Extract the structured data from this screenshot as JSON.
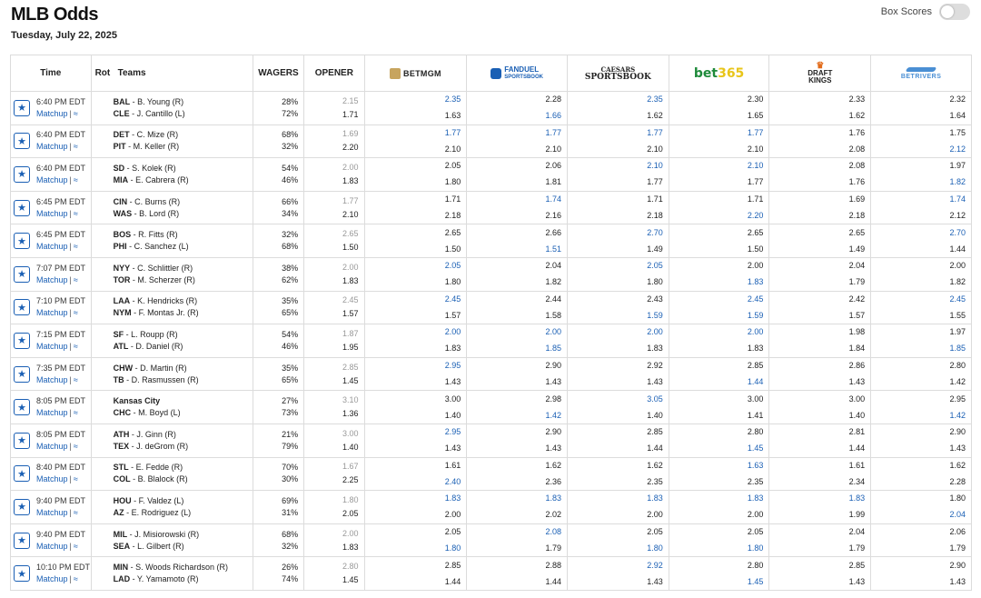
{
  "page": {
    "title": "MLB Odds",
    "date": "Tuesday, July 22, 2025",
    "box_scores_label": "Box Scores",
    "box_scores_on": false
  },
  "headers": {
    "time": "Time",
    "rot": "Rot",
    "teams": "Teams",
    "wagers": "WAGERS",
    "opener": "OPENER"
  },
  "books": [
    {
      "key": "betmgm",
      "label": "BETMGM"
    },
    {
      "key": "fanduel",
      "label": "FANDUEL",
      "sub": "SPORTSBOOK"
    },
    {
      "key": "caesars",
      "label": "CAESARS",
      "sub": "SPORTSBOOK"
    },
    {
      "key": "bet365",
      "label": "bet365"
    },
    {
      "key": "draftkings",
      "label": "DRAFT",
      "sub": "KINGS"
    },
    {
      "key": "betrivers",
      "label": "BETRIVERS"
    }
  ],
  "matchup_label": "Matchup",
  "colors": {
    "best_odds": "#1a5fb4",
    "opener_top": "#999999"
  },
  "games": [
    {
      "time": "6:40 PM EDT",
      "away": {
        "abbr": "BAL",
        "pitcher": "B. Young (R)"
      },
      "home": {
        "abbr": "CLE",
        "pitcher": "J. Cantillo (L)"
      },
      "wagers": [
        "28%",
        "72%"
      ],
      "opener": [
        "2.15",
        "1.71"
      ],
      "odds": [
        [
          "2.35",
          "1.63"
        ],
        [
          "2.28",
          "1.66"
        ],
        [
          "2.35",
          "1.62"
        ],
        [
          "2.30",
          "1.65"
        ],
        [
          "2.33",
          "1.62"
        ],
        [
          "2.32",
          "1.64"
        ]
      ],
      "best": [
        [
          1,
          0
        ],
        [
          0,
          1
        ],
        [
          1,
          0
        ],
        [
          0,
          0
        ],
        [
          0,
          0
        ],
        [
          0,
          0
        ]
      ]
    },
    {
      "time": "6:40 PM EDT",
      "away": {
        "abbr": "DET",
        "pitcher": "C. Mize (R)"
      },
      "home": {
        "abbr": "PIT",
        "pitcher": "M. Keller (R)"
      },
      "wagers": [
        "68%",
        "32%"
      ],
      "opener": [
        "1.69",
        "2.20"
      ],
      "odds": [
        [
          "1.77",
          "2.10"
        ],
        [
          "1.77",
          "2.10"
        ],
        [
          "1.77",
          "2.10"
        ],
        [
          "1.77",
          "2.10"
        ],
        [
          "1.76",
          "2.08"
        ],
        [
          "1.75",
          "2.12"
        ]
      ],
      "best": [
        [
          1,
          0
        ],
        [
          1,
          0
        ],
        [
          1,
          0
        ],
        [
          1,
          0
        ],
        [
          0,
          0
        ],
        [
          0,
          1
        ]
      ]
    },
    {
      "time": "6:40 PM EDT",
      "away": {
        "abbr": "SD",
        "pitcher": "S. Kolek (R)"
      },
      "home": {
        "abbr": "MIA",
        "pitcher": "E. Cabrera (R)"
      },
      "wagers": [
        "54%",
        "46%"
      ],
      "opener": [
        "2.00",
        "1.83"
      ],
      "odds": [
        [
          "2.05",
          "1.80"
        ],
        [
          "2.06",
          "1.81"
        ],
        [
          "2.10",
          "1.77"
        ],
        [
          "2.10",
          "1.77"
        ],
        [
          "2.08",
          "1.76"
        ],
        [
          "1.97",
          "1.82"
        ]
      ],
      "best": [
        [
          0,
          0
        ],
        [
          0,
          0
        ],
        [
          1,
          0
        ],
        [
          1,
          0
        ],
        [
          0,
          0
        ],
        [
          0,
          1
        ]
      ]
    },
    {
      "time": "6:45 PM EDT",
      "away": {
        "abbr": "CIN",
        "pitcher": "C. Burns (R)"
      },
      "home": {
        "abbr": "WAS",
        "pitcher": "B. Lord (R)"
      },
      "wagers": [
        "66%",
        "34%"
      ],
      "opener": [
        "1.77",
        "2.10"
      ],
      "odds": [
        [
          "1.71",
          "2.18"
        ],
        [
          "1.74",
          "2.16"
        ],
        [
          "1.71",
          "2.18"
        ],
        [
          "1.71",
          "2.20"
        ],
        [
          "1.69",
          "2.18"
        ],
        [
          "1.74",
          "2.12"
        ]
      ],
      "best": [
        [
          0,
          0
        ],
        [
          1,
          0
        ],
        [
          0,
          0
        ],
        [
          0,
          1
        ],
        [
          0,
          0
        ],
        [
          1,
          0
        ]
      ]
    },
    {
      "time": "6:45 PM EDT",
      "away": {
        "abbr": "BOS",
        "pitcher": "R. Fitts (R)"
      },
      "home": {
        "abbr": "PHI",
        "pitcher": "C. Sanchez (L)"
      },
      "wagers": [
        "32%",
        "68%"
      ],
      "opener": [
        "2.65",
        "1.50"
      ],
      "odds": [
        [
          "2.65",
          "1.50"
        ],
        [
          "2.66",
          "1.51"
        ],
        [
          "2.70",
          "1.49"
        ],
        [
          "2.65",
          "1.50"
        ],
        [
          "2.65",
          "1.49"
        ],
        [
          "2.70",
          "1.44"
        ]
      ],
      "best": [
        [
          0,
          0
        ],
        [
          0,
          1
        ],
        [
          1,
          0
        ],
        [
          0,
          0
        ],
        [
          0,
          0
        ],
        [
          1,
          0
        ]
      ]
    },
    {
      "time": "7:07 PM EDT",
      "away": {
        "abbr": "NYY",
        "pitcher": "C. Schlittler (R)"
      },
      "home": {
        "abbr": "TOR",
        "pitcher": "M. Scherzer (R)"
      },
      "wagers": [
        "38%",
        "62%"
      ],
      "opener": [
        "2.00",
        "1.83"
      ],
      "odds": [
        [
          "2.05",
          "1.80"
        ],
        [
          "2.04",
          "1.82"
        ],
        [
          "2.05",
          "1.80"
        ],
        [
          "2.00",
          "1.83"
        ],
        [
          "2.04",
          "1.79"
        ],
        [
          "2.00",
          "1.82"
        ]
      ],
      "best": [
        [
          1,
          0
        ],
        [
          0,
          0
        ],
        [
          1,
          0
        ],
        [
          0,
          1
        ],
        [
          0,
          0
        ],
        [
          0,
          0
        ]
      ]
    },
    {
      "time": "7:10 PM EDT",
      "away": {
        "abbr": "LAA",
        "pitcher": "K. Hendricks (R)"
      },
      "home": {
        "abbr": "NYM",
        "pitcher": "F. Montas Jr. (R)"
      },
      "wagers": [
        "35%",
        "65%"
      ],
      "opener": [
        "2.45",
        "1.57"
      ],
      "odds": [
        [
          "2.45",
          "1.57"
        ],
        [
          "2.44",
          "1.58"
        ],
        [
          "2.43",
          "1.59"
        ],
        [
          "2.45",
          "1.59"
        ],
        [
          "2.42",
          "1.57"
        ],
        [
          "2.45",
          "1.55"
        ]
      ],
      "best": [
        [
          1,
          0
        ],
        [
          0,
          0
        ],
        [
          0,
          1
        ],
        [
          1,
          1
        ],
        [
          0,
          0
        ],
        [
          1,
          0
        ]
      ]
    },
    {
      "time": "7:15 PM EDT",
      "away": {
        "abbr": "SF",
        "pitcher": "L. Roupp (R)"
      },
      "home": {
        "abbr": "ATL",
        "pitcher": "D. Daniel (R)"
      },
      "wagers": [
        "54%",
        "46%"
      ],
      "opener": [
        "1.87",
        "1.95"
      ],
      "odds": [
        [
          "2.00",
          "1.83"
        ],
        [
          "2.00",
          "1.85"
        ],
        [
          "2.00",
          "1.83"
        ],
        [
          "2.00",
          "1.83"
        ],
        [
          "1.98",
          "1.84"
        ],
        [
          "1.97",
          "1.85"
        ]
      ],
      "best": [
        [
          1,
          0
        ],
        [
          1,
          1
        ],
        [
          1,
          0
        ],
        [
          1,
          0
        ],
        [
          0,
          0
        ],
        [
          0,
          1
        ]
      ]
    },
    {
      "time": "7:35 PM EDT",
      "away": {
        "abbr": "CHW",
        "pitcher": "D. Martin (R)"
      },
      "home": {
        "abbr": "TB",
        "pitcher": "D. Rasmussen (R)"
      },
      "wagers": [
        "35%",
        "65%"
      ],
      "opener": [
        "2.85",
        "1.45"
      ],
      "odds": [
        [
          "2.95",
          "1.43"
        ],
        [
          "2.90",
          "1.43"
        ],
        [
          "2.92",
          "1.43"
        ],
        [
          "2.85",
          "1.44"
        ],
        [
          "2.86",
          "1.43"
        ],
        [
          "2.80",
          "1.42"
        ]
      ],
      "best": [
        [
          1,
          0
        ],
        [
          0,
          0
        ],
        [
          0,
          0
        ],
        [
          0,
          1
        ],
        [
          0,
          0
        ],
        [
          0,
          0
        ]
      ]
    },
    {
      "time": "8:05 PM EDT",
      "away": {
        "abbr": "Kansas City",
        "pitcher": ""
      },
      "home": {
        "abbr": "CHC",
        "pitcher": "M. Boyd (L)"
      },
      "wagers": [
        "27%",
        "73%"
      ],
      "opener": [
        "3.10",
        "1.36"
      ],
      "odds": [
        [
          "3.00",
          "1.40"
        ],
        [
          "2.98",
          "1.42"
        ],
        [
          "3.05",
          "1.40"
        ],
        [
          "3.00",
          "1.41"
        ],
        [
          "3.00",
          "1.40"
        ],
        [
          "2.95",
          "1.42"
        ]
      ],
      "best": [
        [
          0,
          0
        ],
        [
          0,
          1
        ],
        [
          1,
          0
        ],
        [
          0,
          0
        ],
        [
          0,
          0
        ],
        [
          0,
          1
        ]
      ]
    },
    {
      "time": "8:05 PM EDT",
      "away": {
        "abbr": "ATH",
        "pitcher": "J. Ginn (R)"
      },
      "home": {
        "abbr": "TEX",
        "pitcher": "J. deGrom (R)"
      },
      "wagers": [
        "21%",
        "79%"
      ],
      "opener": [
        "3.00",
        "1.40"
      ],
      "odds": [
        [
          "2.95",
          "1.43"
        ],
        [
          "2.90",
          "1.43"
        ],
        [
          "2.85",
          "1.44"
        ],
        [
          "2.80",
          "1.45"
        ],
        [
          "2.81",
          "1.44"
        ],
        [
          "2.90",
          "1.43"
        ]
      ],
      "best": [
        [
          1,
          0
        ],
        [
          0,
          0
        ],
        [
          0,
          0
        ],
        [
          0,
          1
        ],
        [
          0,
          0
        ],
        [
          0,
          0
        ]
      ]
    },
    {
      "time": "8:40 PM EDT",
      "away": {
        "abbr": "STL",
        "pitcher": "E. Fedde (R)"
      },
      "home": {
        "abbr": "COL",
        "pitcher": "B. Blalock (R)"
      },
      "wagers": [
        "70%",
        "30%"
      ],
      "opener": [
        "1.67",
        "2.25"
      ],
      "odds": [
        [
          "1.61",
          "2.40"
        ],
        [
          "1.62",
          "2.36"
        ],
        [
          "1.62",
          "2.35"
        ],
        [
          "1.63",
          "2.35"
        ],
        [
          "1.61",
          "2.34"
        ],
        [
          "1.62",
          "2.28"
        ]
      ],
      "best": [
        [
          0,
          1
        ],
        [
          0,
          0
        ],
        [
          0,
          0
        ],
        [
          1,
          0
        ],
        [
          0,
          0
        ],
        [
          0,
          0
        ]
      ]
    },
    {
      "time": "9:40 PM EDT",
      "away": {
        "abbr": "HOU",
        "pitcher": "F. Valdez (L)"
      },
      "home": {
        "abbr": "AZ",
        "pitcher": "E. Rodriguez (L)"
      },
      "wagers": [
        "69%",
        "31%"
      ],
      "opener": [
        "1.80",
        "2.05"
      ],
      "odds": [
        [
          "1.83",
          "2.00"
        ],
        [
          "1.83",
          "2.02"
        ],
        [
          "1.83",
          "2.00"
        ],
        [
          "1.83",
          "2.00"
        ],
        [
          "1.83",
          "1.99"
        ],
        [
          "1.80",
          "2.04"
        ]
      ],
      "best": [
        [
          1,
          0
        ],
        [
          1,
          0
        ],
        [
          1,
          0
        ],
        [
          1,
          0
        ],
        [
          1,
          0
        ],
        [
          0,
          1
        ]
      ]
    },
    {
      "time": "9:40 PM EDT",
      "away": {
        "abbr": "MIL",
        "pitcher": "J. Misiorowski (R)"
      },
      "home": {
        "abbr": "SEA",
        "pitcher": "L. Gilbert (R)"
      },
      "wagers": [
        "68%",
        "32%"
      ],
      "opener": [
        "2.00",
        "1.83"
      ],
      "odds": [
        [
          "2.05",
          "1.80"
        ],
        [
          "2.08",
          "1.79"
        ],
        [
          "2.05",
          "1.80"
        ],
        [
          "2.05",
          "1.80"
        ],
        [
          "2.04",
          "1.79"
        ],
        [
          "2.06",
          "1.79"
        ]
      ],
      "best": [
        [
          0,
          1
        ],
        [
          1,
          0
        ],
        [
          0,
          1
        ],
        [
          0,
          1
        ],
        [
          0,
          0
        ],
        [
          0,
          0
        ]
      ]
    },
    {
      "time": "10:10 PM EDT",
      "away": {
        "abbr": "MIN",
        "pitcher": "S. Woods Richardson (R)"
      },
      "home": {
        "abbr": "LAD",
        "pitcher": "Y. Yamamoto (R)"
      },
      "wagers": [
        "26%",
        "74%"
      ],
      "opener": [
        "2.80",
        "1.45"
      ],
      "odds": [
        [
          "2.85",
          "1.44"
        ],
        [
          "2.88",
          "1.44"
        ],
        [
          "2.92",
          "1.43"
        ],
        [
          "2.80",
          "1.45"
        ],
        [
          "2.85",
          "1.43"
        ],
        [
          "2.90",
          "1.43"
        ]
      ],
      "best": [
        [
          0,
          0
        ],
        [
          0,
          0
        ],
        [
          1,
          0
        ],
        [
          0,
          1
        ],
        [
          0,
          0
        ],
        [
          0,
          0
        ]
      ]
    }
  ]
}
